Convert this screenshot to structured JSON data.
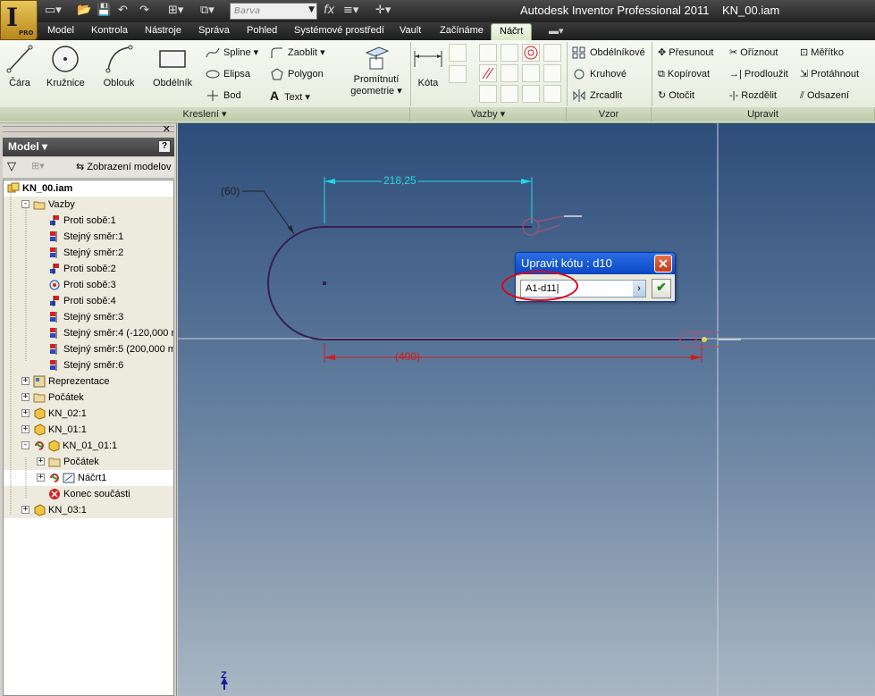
{
  "app": {
    "title": "Autodesk Inventor Professional 2011",
    "document": "KN_00.iam",
    "logo_letter": "I",
    "logo_badge": "PRO"
  },
  "quick_access": {
    "style_combo": "Barva",
    "fx_label": "fx"
  },
  "tabs": [
    {
      "label": "Model"
    },
    {
      "label": "Kontrola"
    },
    {
      "label": "Nástroje"
    },
    {
      "label": "Správa"
    },
    {
      "label": "Pohled"
    },
    {
      "label": "Systémové prostředí"
    },
    {
      "label": "Vault"
    },
    {
      "label": "Začínáme"
    },
    {
      "label": "Náčrt",
      "active": true
    }
  ],
  "ribbon": {
    "groups": {
      "kresleni": "Kreslení",
      "vazby": "Vazby",
      "vzor": "Vzor",
      "upravit": "Upravit"
    },
    "kresleni": {
      "cara": "Čára",
      "kruznice": "Kružnice",
      "oblouk": "Oblouk",
      "obdelnik": "Obdélník",
      "spline": "Spline",
      "elipsa": "Elipsa",
      "bod": "Bod",
      "zaoblit": "Zaoblit",
      "polygon": "Polygon",
      "text": "Text",
      "promitnuti_1": "Promítnutí",
      "promitnuti_2": "geometrie"
    },
    "vazby": {
      "kota": "Kóta"
    },
    "vzor": {
      "obdelnikove": "Obdélníkové",
      "kruhove": "Kruhové",
      "zrcadlit": "Zrcadlit"
    },
    "upravit": {
      "presunout": "Přesunout",
      "kopirovat": "Kopírovat",
      "otocit": "Otočit",
      "oriznout": "Oříznout",
      "prodlouzit": "Prodloužit",
      "rozdelit": "Rozdělit",
      "meritko": "Měřítko",
      "protahnout": "Protáhnout",
      "odsazeni": "Odsazení"
    }
  },
  "browser": {
    "header": "Model",
    "help": "?",
    "view_label": "Zobrazení modelov",
    "tree": [
      {
        "label": "KN_00.iam",
        "level": 0,
        "bold": true,
        "icon": "assembly-icon"
      },
      {
        "label": "Vazby",
        "level": 1,
        "expand": "-",
        "icon": "folder-open-icon"
      },
      {
        "label": "Proti sobě:1",
        "level": 2,
        "icon": "mate-constraint-icon"
      },
      {
        "label": "Stejný směr:1",
        "level": 2,
        "icon": "flush-constraint-icon"
      },
      {
        "label": "Stejný směr:2",
        "level": 2,
        "icon": "flush-constraint-icon"
      },
      {
        "label": "Proti sobě:2",
        "level": 2,
        "icon": "mate-constraint-icon"
      },
      {
        "label": "Proti sobě:3",
        "level": 2,
        "icon": "tangent-constraint-icon"
      },
      {
        "label": "Proti sobě:4",
        "level": 2,
        "icon": "mate-constraint-icon"
      },
      {
        "label": "Stejný směr:3",
        "level": 2,
        "icon": "flush-constraint-icon"
      },
      {
        "label": "Stejný směr:4 (-120,000 m",
        "level": 2,
        "icon": "flush-constraint-icon"
      },
      {
        "label": "Stejný směr:5 (200,000 mr",
        "level": 2,
        "icon": "flush-constraint-icon"
      },
      {
        "label": "Stejný směr:6",
        "level": 2,
        "icon": "flush-constraint-icon"
      },
      {
        "label": "Reprezentace",
        "level": 1,
        "expand": "+",
        "icon": "representation-icon"
      },
      {
        "label": "Počátek",
        "level": 1,
        "expand": "+",
        "icon": "folder-icon"
      },
      {
        "label": "KN_02:1",
        "level": 1,
        "expand": "+",
        "icon": "part-icon"
      },
      {
        "label": "KN_01:1",
        "level": 1,
        "expand": "+",
        "icon": "part-icon"
      },
      {
        "label": "KN_01_01:1",
        "level": 1,
        "expand": "-",
        "icon": "part-edit-icon"
      },
      {
        "label": "Počátek",
        "level": 2,
        "expand": "+",
        "icon": "folder-icon"
      },
      {
        "label": "Náčrt1",
        "level": 2,
        "expand": "+",
        "icon": "sketch-icon"
      },
      {
        "label": "Konec součásti",
        "level": 2,
        "icon": "end-of-part-icon"
      },
      {
        "label": "KN_03:1",
        "level": 1,
        "expand": "+",
        "icon": "part-icon"
      }
    ]
  },
  "sketch": {
    "dim_top": "218,25",
    "dim_radius": "(60)",
    "dim_bottom": "(400)",
    "axis_label": "Z"
  },
  "dialog": {
    "title": "Upravit kótu : d10",
    "close": "✕",
    "value": "A1-d11",
    "ok": "✔"
  },
  "colors": {
    "sketch_line": "#3b1d52",
    "dim_cyan": "#22d8e8",
    "dim_red": "#d21a1a",
    "accent_tab": "#e4efd6"
  }
}
